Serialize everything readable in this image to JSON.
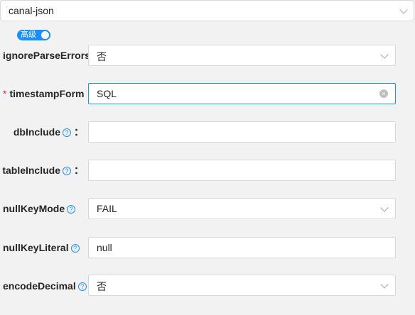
{
  "format_select": {
    "value": "canal-json"
  },
  "advanced_toggle": {
    "label": "高级",
    "on": true
  },
  "fields": {
    "ignoreParseErrors": {
      "label": "ignoreParseErrors",
      "value": "否"
    },
    "timestampFormat": {
      "label": "timestampForm",
      "value": "SQL",
      "required": true
    },
    "dbInclude": {
      "label": "dbInclude",
      "value": "",
      "help": "?",
      "colon": "："
    },
    "tableInclude": {
      "label": "tableInclude",
      "value": "",
      "help": "?",
      "colon": "："
    },
    "nullKeyMode": {
      "label": "nullKeyMode",
      "value": "FAIL",
      "help": "?"
    },
    "nullKeyLiteral": {
      "label": "nullKeyLiteral",
      "value": "null",
      "help": "?"
    },
    "encodeDecimal": {
      "label": "encodeDecimal",
      "value": "否",
      "help": "?"
    }
  },
  "required_mark": "*",
  "icons": {
    "clear": "×"
  },
  "colors": {
    "accent": "#1890ff",
    "required": "#f5222d"
  }
}
